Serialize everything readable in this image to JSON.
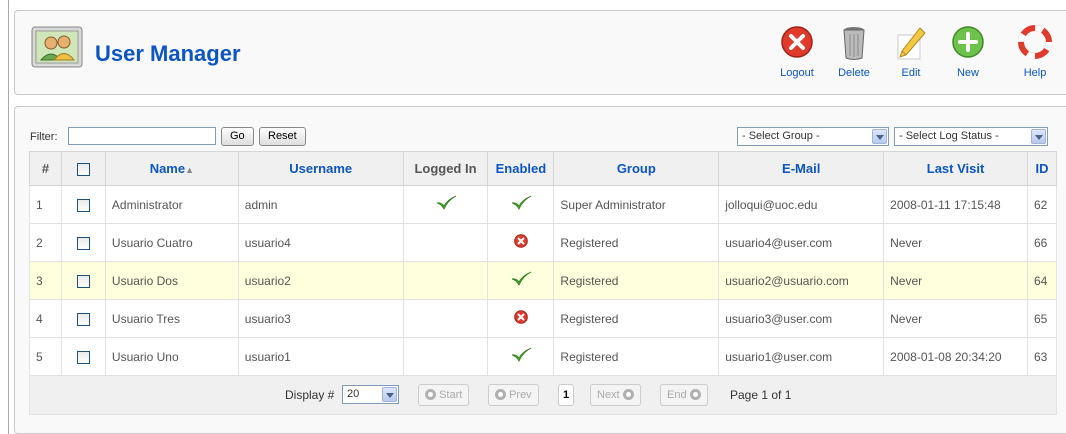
{
  "header": {
    "title": "User Manager",
    "toolbar": [
      {
        "label": "Logout",
        "icon": "logout-icon"
      },
      {
        "label": "Delete",
        "icon": "trash-icon"
      },
      {
        "label": "Edit",
        "icon": "pencil-icon"
      },
      {
        "label": "New",
        "icon": "plus-icon"
      },
      {
        "label": "Help",
        "icon": "lifebuoy-icon"
      }
    ]
  },
  "filter": {
    "label": "Filter:",
    "value": "",
    "go_label": "Go",
    "reset_label": "Reset",
    "group_select": "- Select Group -",
    "log_select": "- Select Log Status -"
  },
  "table": {
    "columns": [
      "#",
      "",
      "Name",
      "Username",
      "Logged In",
      "Enabled",
      "Group",
      "E-Mail",
      "Last Visit",
      "ID"
    ],
    "rows": [
      {
        "num": "1",
        "name": "Administrator",
        "username": "admin",
        "logged_in": true,
        "enabled": true,
        "group": "Super Administrator",
        "email": "jolloqui@uoc.edu",
        "last_visit": "2008-01-11 17:15:48",
        "id": "62"
      },
      {
        "num": "2",
        "name": "Usuario Cuatro",
        "username": "usuario4",
        "logged_in": false,
        "enabled": false,
        "group": "Registered",
        "email": "usuario4@user.com",
        "last_visit": "Never",
        "id": "66"
      },
      {
        "num": "3",
        "name": "Usuario Dos",
        "username": "usuario2",
        "logged_in": false,
        "enabled": true,
        "group": "Registered",
        "email": "usuario2@usuario.com",
        "last_visit": "Never",
        "id": "64"
      },
      {
        "num": "4",
        "name": "Usuario Tres",
        "username": "usuario3",
        "logged_in": false,
        "enabled": false,
        "group": "Registered",
        "email": "usuario3@user.com",
        "last_visit": "Never",
        "id": "65"
      },
      {
        "num": "5",
        "name": "Usuario Uno",
        "username": "usuario1",
        "logged_in": false,
        "enabled": true,
        "group": "Registered",
        "email": "usuario1@user.com",
        "last_visit": "2008-01-08 20:34:20",
        "id": "63"
      }
    ],
    "highlighted_row": "3"
  },
  "pager": {
    "display_label": "Display #",
    "display_value": "20",
    "start": "Start",
    "prev": "Prev",
    "current": "1",
    "next": "Next",
    "end": "End",
    "page_of": "Page 1 of 1"
  },
  "colors": {
    "link": "#0b55c4",
    "enabled_check": "#4caf32",
    "disabled_x": "#e03a2a",
    "highlight_row": "#ffffdd"
  }
}
